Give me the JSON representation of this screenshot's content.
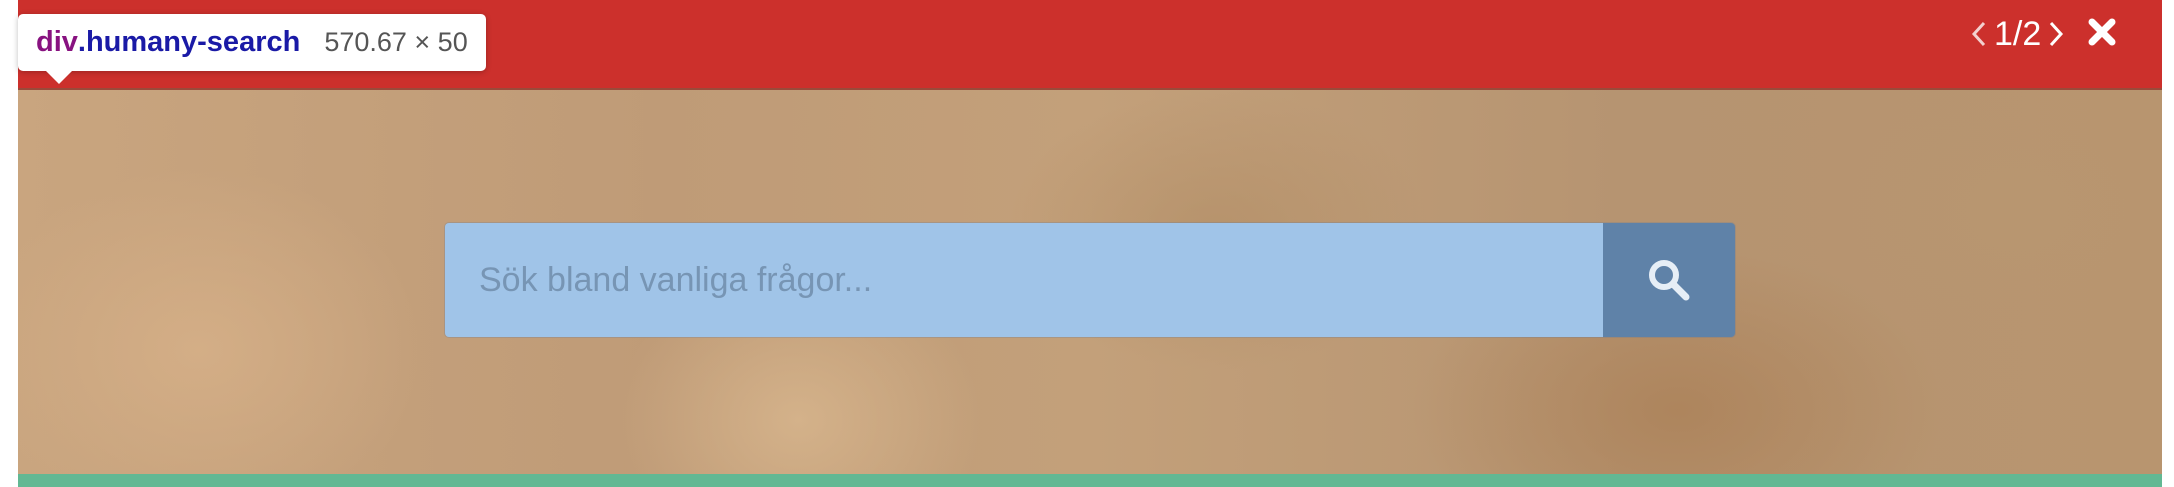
{
  "inspector": {
    "tag": "div",
    "class_name": ".humany-search",
    "size": "570.67 × 50"
  },
  "pager": {
    "text": "1/2"
  },
  "search": {
    "placeholder": "Sök bland vanliga frågor..."
  },
  "icons": {
    "prev": "chevron-left-icon",
    "next": "chevron-right-icon",
    "close": "close-icon",
    "search": "search-icon"
  },
  "colors": {
    "top_bar": "#cc302c",
    "search_input_bg": "#a0c4e8",
    "search_button_bg": "#5f82a8",
    "bottom_strip": "#62b893"
  }
}
